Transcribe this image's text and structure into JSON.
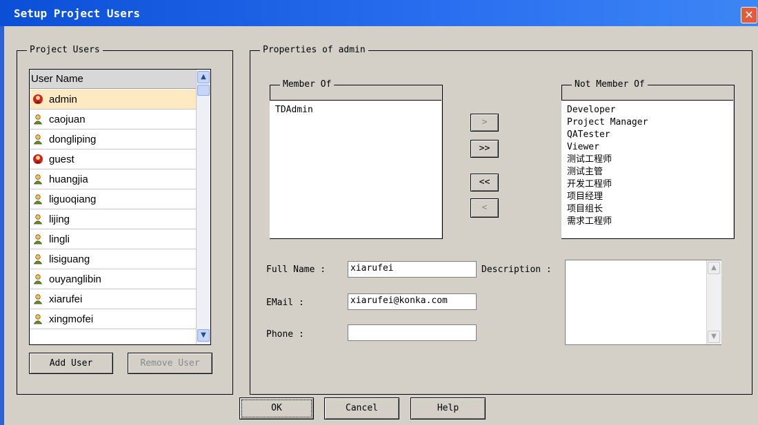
{
  "window": {
    "title": "Setup Project Users",
    "close_glyph": "✕"
  },
  "project_users": {
    "legend": "Project Users",
    "column_header": "User Name",
    "users": [
      {
        "name": "admin",
        "icon": "admin-user-icon",
        "selected": true
      },
      {
        "name": "caojuan",
        "icon": "user-icon"
      },
      {
        "name": "dongliping",
        "icon": "user-icon"
      },
      {
        "name": "guest",
        "icon": "admin-user-icon"
      },
      {
        "name": "huangjia",
        "icon": "user-icon"
      },
      {
        "name": "liguoqiang",
        "icon": "user-icon"
      },
      {
        "name": "lijing",
        "icon": "user-icon"
      },
      {
        "name": "lingli",
        "icon": "user-icon"
      },
      {
        "name": "lisiguang",
        "icon": "user-icon"
      },
      {
        "name": "ouyanglibin",
        "icon": "user-icon"
      },
      {
        "name": "xiarufei",
        "icon": "user-icon"
      },
      {
        "name": "xingmofei",
        "icon": "user-icon"
      }
    ],
    "add_user_label": "Add User",
    "remove_user_label": "Remove User"
  },
  "properties": {
    "legend": "Properties of admin",
    "member_of": {
      "legend": "Member Of",
      "items": [
        "TDAdmin"
      ]
    },
    "not_member_of": {
      "legend": "Not Member Of",
      "items": [
        "Developer",
        "Project Manager",
        "QATester",
        "Viewer",
        "测试工程师",
        "测试主管",
        "开发工程师",
        "项目经理",
        "项目组长",
        "需求工程师"
      ]
    },
    "move_buttons": {
      "add_one": ">",
      "add_all": ">>",
      "remove_all": "<<",
      "remove_one": "<"
    },
    "full_name": {
      "label": "Full Name :",
      "value": "xiarufei"
    },
    "email": {
      "label": "EMail :",
      "value": "xiarufei@konka.com"
    },
    "phone": {
      "label": "Phone :",
      "value": ""
    },
    "description": {
      "label": "Description :",
      "value": ""
    }
  },
  "footer": {
    "ok_label": "OK",
    "cancel_label": "Cancel",
    "help_label": "Help"
  },
  "colors": {
    "titlebar": "#0a4fd6",
    "dialog_bg": "#d4d0c8",
    "selected_row": "#fde9c2",
    "close_button": "#e25b3d"
  }
}
